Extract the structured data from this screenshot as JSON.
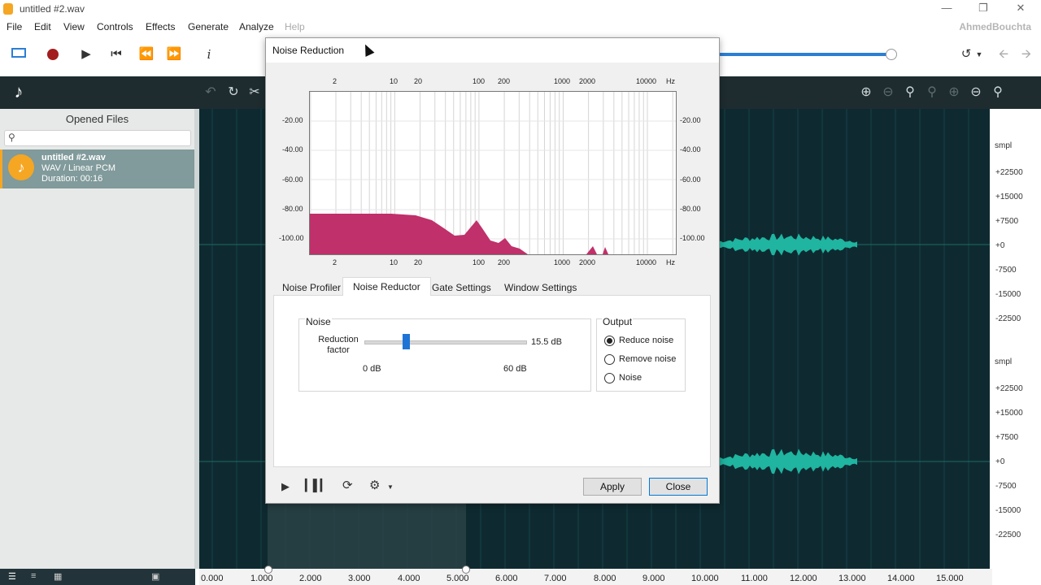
{
  "app": {
    "window_title": "untitled #2.wav",
    "brand": "AhmedBouchta"
  },
  "menu": [
    "File",
    "Edit",
    "View",
    "Controls",
    "Effects",
    "Generate",
    "Analyze",
    "Help"
  ],
  "sidebar": {
    "header": "Opened Files",
    "file": {
      "name": "untitled #2.wav",
      "format": "WAV / Linear PCM",
      "duration": "Duration: 00:16"
    }
  },
  "waveform": {
    "unit": "smpl",
    "upper_scale": [
      "+22500",
      "+15000",
      "+7500",
      "+0",
      "-7500",
      "-15000",
      "-22500"
    ],
    "lower_scale": [
      "+22500",
      "+15000",
      "+7500",
      "+0",
      "-7500",
      "-15000",
      "-22500"
    ],
    "timeline": [
      "0.000",
      "1.000",
      "2.000",
      "3.000",
      "4.000",
      "5.000",
      "6.000",
      "7.000",
      "8.000",
      "9.000",
      "10.000",
      "11.000",
      "12.000",
      "13.000",
      "14.000",
      "15.000"
    ],
    "colors": {
      "background": "#0e2a30",
      "wave": "#1fb5a0"
    }
  },
  "dialog": {
    "title": "Noise Reduction",
    "hz_ticks": [
      "2",
      "10",
      "20",
      "100",
      "200",
      "1000",
      "2000",
      "10000"
    ],
    "hz_unit": "Hz",
    "db_ticks": [
      "-20.00",
      "-40.00",
      "-60.00",
      "-80.00",
      "-100.00"
    ],
    "tabs": [
      "Noise Profiler",
      "Noise Reductor",
      "Gate Settings",
      "Window Settings"
    ],
    "active_tab": "Noise Reductor",
    "noise_group": {
      "title": "Noise",
      "label": "Reduction factor",
      "value": "15.5 dB",
      "value_fraction": 0.26,
      "min": "0 dB",
      "max": "60 dB"
    },
    "output_group": {
      "title": "Output",
      "options": [
        "Reduce noise",
        "Remove noise",
        "Noise"
      ],
      "selected": "Reduce noise"
    },
    "buttons": {
      "apply": "Apply",
      "close": "Close"
    },
    "spectrum_color": "#c0306a"
  }
}
